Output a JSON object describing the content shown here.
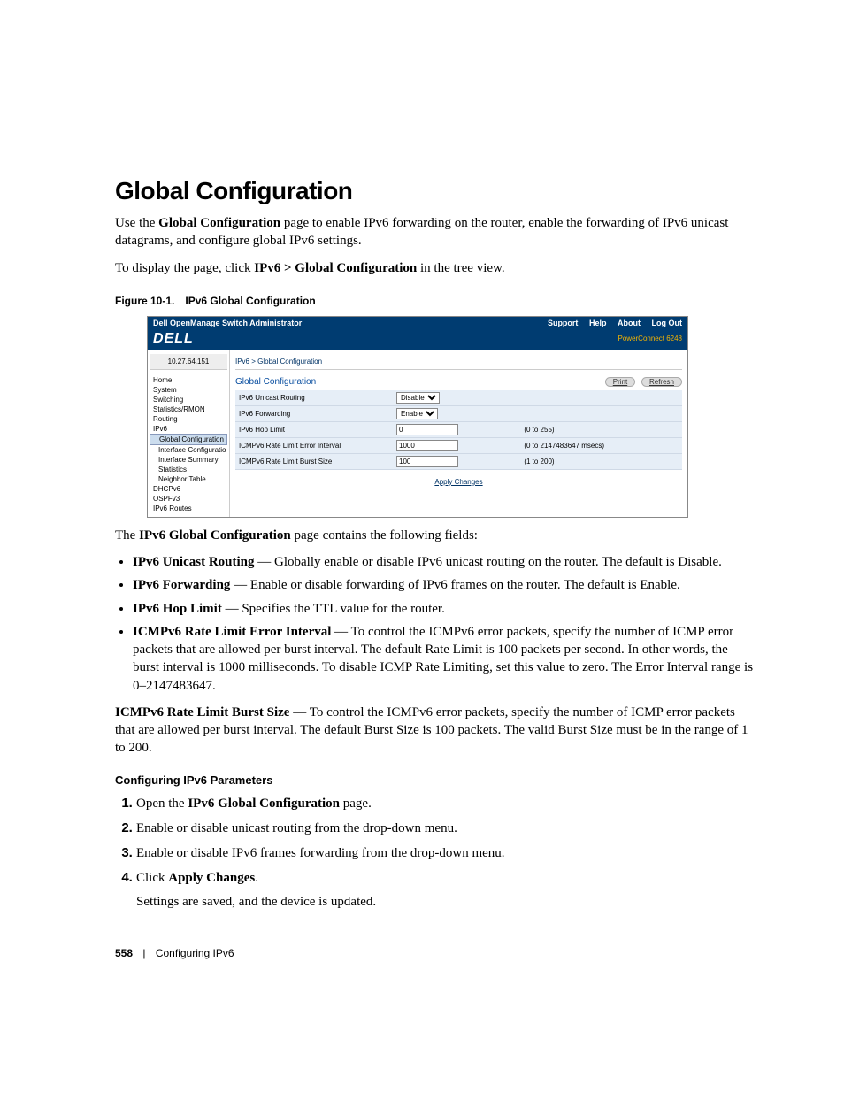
{
  "heading": "Global Configuration",
  "intro1a": "Use the ",
  "intro1b": "Global Configuration",
  "intro1c": " page to enable IPv6 forwarding on the router, enable the forwarding of IPv6 unicast datagrams, and configure global IPv6 settings.",
  "intro2a": "To display the page, click ",
  "intro2b": "IPv6 > Global Configuration",
  "intro2c": " in the tree view.",
  "figcap": "Figure 10-1. IPv6 Global Configuration",
  "shot": {
    "title": "Dell OpenManage Switch Administrator",
    "links": {
      "support": "Support",
      "help": "Help",
      "about": "About",
      "logout": "Log Out"
    },
    "logo": "DELL",
    "device": "PowerConnect 6248",
    "ip": "10.27.64.151",
    "tree": {
      "home": "Home",
      "system": "System",
      "switching": "Switching",
      "stats": "Statistics/RMON",
      "routing": "Routing",
      "ipv6": "IPv6",
      "globalcfg": "Global Configuration",
      "ifcfg": "Interface Configuratio",
      "ifsum": "Interface Summary",
      "statsnode": "Statistics",
      "neighbor": "Neighbor Table",
      "dhcpv6": "DHCPv6",
      "ospfv3": "OSPFv3",
      "routes": "IPv6 Routes"
    },
    "crumb": "IPv6 > Global Configuration",
    "pgtitle": "Global Configuration",
    "btn_print": "Print",
    "btn_refresh": "Refresh",
    "rows": {
      "r1": {
        "label": "IPv6 Unicast Routing",
        "value": "Disable"
      },
      "r2": {
        "label": "IPv6 Forwarding",
        "value": "Enable"
      },
      "r3": {
        "label": "IPv6 Hop Limit",
        "value": "0",
        "hint": "(0 to 255)"
      },
      "r4": {
        "label": "ICMPv6 Rate Limit Error Interval",
        "value": "1000",
        "hint": "(0 to 2147483647 msecs)"
      },
      "r5": {
        "label": "ICMPv6 Rate Limit Burst Size",
        "value": "100",
        "hint": "(1 to 200)"
      }
    },
    "apply": "Apply Changes"
  },
  "afterfig_a": "The ",
  "afterfig_b": "IPv6 Global Configuration",
  "afterfig_c": " page contains the following fields:",
  "bullets": {
    "b1": {
      "term": "IPv6 Unicast Routing",
      "text": " — Globally enable or disable IPv6 unicast routing on the router. The default is Disable."
    },
    "b2": {
      "term": "IPv6 Forwarding",
      "text": " — Enable or disable forwarding of IPv6 frames on the router. The default is Enable."
    },
    "b3": {
      "term": "IPv6 Hop Limit",
      "text": " — Specifies the TTL value for the router."
    },
    "b4": {
      "term": "ICMPv6 Rate Limit Error Interval",
      "text": " — To control the ICMPv6 error packets, specify the number of ICMP error packets that are allowed per burst interval. The default Rate Limit is 100 packets per second. In other words, the burst interval is 1000 milliseconds. To disable ICMP Rate Limiting, set this value to zero. The Error Interval range is 0–2147483647."
    }
  },
  "burstpara_term": "ICMPv6 Rate Limit Burst Size",
  "burstpara_text": " — To control the ICMPv6 error packets, specify the number of ICMP error packets that are allowed per burst interval. The default Burst Size is 100 packets. The valid Burst Size must be in the range of 1 to 200.",
  "subhead": "Configuring IPv6 Parameters",
  "steps": {
    "s1a": "Open the ",
    "s1b": "IPv6 Global Configuration",
    "s1c": " page.",
    "s2": "Enable or disable unicast routing from the drop-down menu.",
    "s3": "Enable or disable IPv6 frames forwarding from the drop-down menu.",
    "s4a": "Click ",
    "s4b": "Apply Changes",
    "s4c": ".",
    "s4d": "Settings are saved, and the device is updated."
  },
  "footer": {
    "page": "558",
    "chapter": "Configuring IPv6"
  }
}
